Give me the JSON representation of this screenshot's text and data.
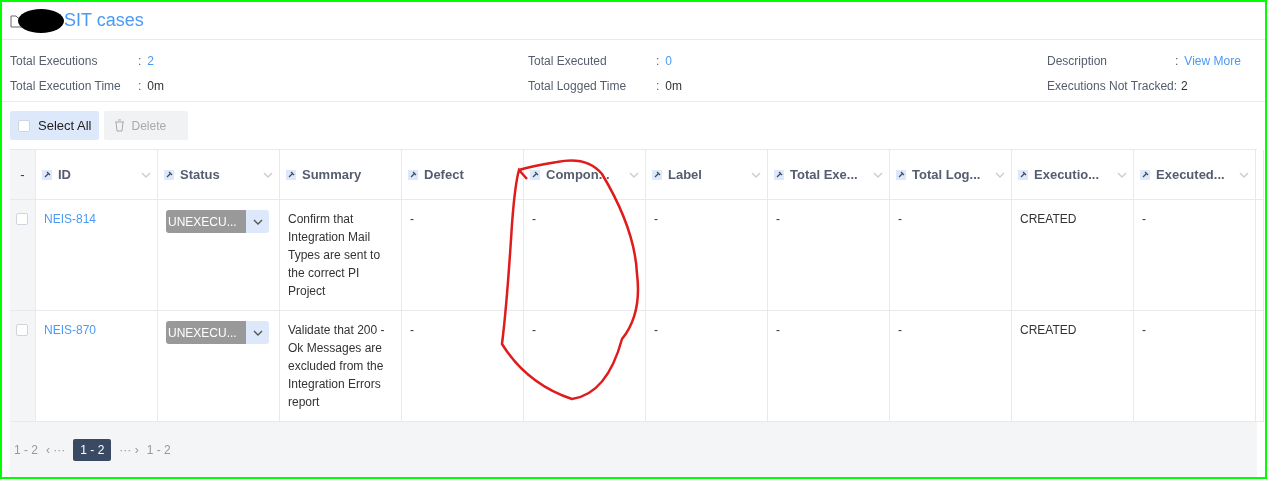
{
  "header": {
    "title": "SIT cases"
  },
  "stats": [
    [
      {
        "label": "Total Executions",
        "separator": ":",
        "value": "2",
        "link": true
      },
      {
        "label": "Total Execution Time",
        "separator": ":",
        "value": "0m",
        "link": false
      }
    ],
    [
      {
        "label": "Total Executed",
        "separator": ":",
        "value": "0",
        "link": true
      },
      {
        "label": "Total Logged Time",
        "separator": ":",
        "value": "0m",
        "link": false
      }
    ],
    [
      {
        "label": "Description",
        "separator": ":",
        "value": "View More",
        "link": true
      },
      {
        "label": "Executions Not Tracked:",
        "value": "2",
        "link": false
      }
    ]
  ],
  "toolbar": {
    "select_all": {
      "label": "Select All",
      "checked": false
    },
    "delete": {
      "label": "Delete",
      "disabled": true
    }
  },
  "table": {
    "select_column": "-",
    "columns": [
      {
        "label": "ID",
        "menu": true
      },
      {
        "label": "Status",
        "menu": true
      },
      {
        "label": "Summary",
        "menu": false
      },
      {
        "label": "Defect",
        "menu": false
      },
      {
        "label": "Compon...",
        "menu": true
      },
      {
        "label": "Label",
        "menu": true
      },
      {
        "label": "Total Exe...",
        "menu": true
      },
      {
        "label": "Total Log...",
        "menu": true
      },
      {
        "label": "Executio...",
        "menu": true
      },
      {
        "label": "Executed...",
        "menu": true
      }
    ],
    "rows": [
      {
        "checked": false,
        "id": "NEIS-814",
        "status": "UNEXECU...",
        "summary": "Confirm that Integration Mail Types are sent to the correct PI Project",
        "cells": [
          "-",
          "-",
          "-",
          "-",
          "-",
          "CREATED",
          "-"
        ]
      },
      {
        "checked": false,
        "id": "NEIS-870",
        "status": "UNEXECU...",
        "summary": "Validate that 200 - Ok Messages are excluded from the Integration Errors report",
        "cells": [
          "-",
          "-",
          "-",
          "-",
          "-",
          "CREATED",
          "-"
        ]
      }
    ]
  },
  "pagination": {
    "range_before": "1 - 2",
    "prev": "‹ ···",
    "current": "1 - 2",
    "next": "··· ›",
    "range_after": "1 - 2"
  }
}
